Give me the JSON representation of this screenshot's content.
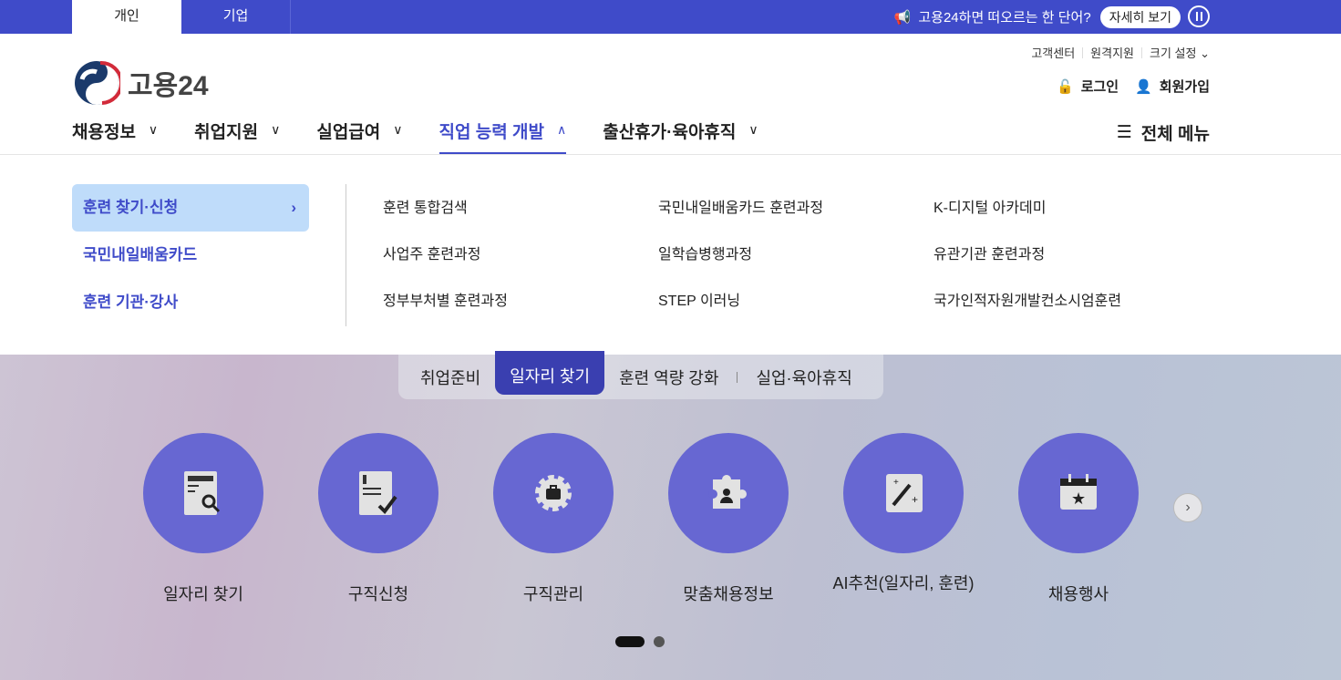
{
  "top_tabs": [
    "개인",
    "기업"
  ],
  "notice": {
    "text": "고용24하면 떠오르는 한 단어?",
    "button": "자세히 보기"
  },
  "util": [
    "고객센터",
    "원격지원",
    "크기 설정"
  ],
  "logo": "고용24",
  "auth": {
    "login": "로그인",
    "signup": "회원가입"
  },
  "gnb": [
    "채용정보",
    "취업지원",
    "실업급여",
    "직업 능력 개발",
    "출산휴가·육아휴직"
  ],
  "all_menu": "전체 메뉴",
  "mega": {
    "side": [
      "훈련 찾기·신청",
      "국민내일배움카드",
      "훈련 기관·강사"
    ],
    "links": [
      "훈련 통합검색",
      "국민내일배움카드 훈련과정",
      "K-디지털 아카데미",
      "사업주 훈련과정",
      "일학습병행과정",
      "유관기관 훈련과정",
      "정부부처별 훈련과정",
      "STEP 이러닝",
      "국가인적자원개발컨소시엄훈련"
    ]
  },
  "hero": {
    "tabs": [
      "취업준비",
      "일자리 찾기",
      "훈련 역량 강화",
      "실업·육아휴직"
    ],
    "items": [
      "일자리 찾기",
      "구직신청",
      "구직관리",
      "맞춤채용정보",
      "AI추천(일자리, 훈련)",
      "채용행사"
    ],
    "page": 1,
    "pages": 2
  }
}
